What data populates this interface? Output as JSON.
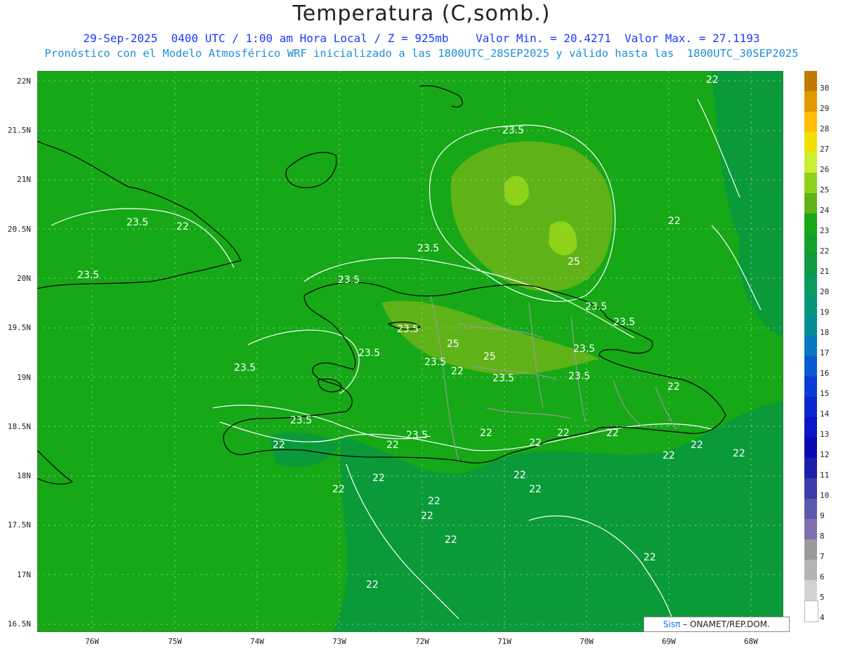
{
  "header": {
    "title": "Temperatura (C,somb.)",
    "subtitle_line1": "29-Sep-2025  0400 UTC / 1:00 am Hora Local / Z = 925mb    Valor Min. = 20.4271  Valor Max. = 27.1193",
    "subtitle_line2": "Pronóstico con el Modelo Atmosférico WRF inicializado a las 1800UTC_28SEP2025 y válido hasta las  1800UTC_30SEP2025"
  },
  "map": {
    "lat_labels": [
      "22N",
      "21.5N",
      "21N",
      "20.5N",
      "20N",
      "19.5N",
      "19N",
      "18.5N",
      "18N",
      "17.5N",
      "17N",
      "16.5N"
    ],
    "lon_labels": [
      "76W",
      "75W",
      "74W",
      "73W",
      "72W",
      "71W",
      "70W",
      "69W",
      "68W"
    ],
    "contour_labels": [
      "22",
      "23.5",
      "22",
      "23.5",
      "23.5",
      "23.5",
      "23.5",
      "25",
      "22",
      "25",
      "23.5",
      "23.5",
      "23.5",
      "23.5",
      "23.5",
      "23.5",
      "23.5",
      "25",
      "22",
      "23.5",
      "23.5",
      "22",
      "23.5",
      "22",
      "22",
      "23.5",
      "22",
      "22",
      "22",
      "22",
      "22",
      "22",
      "22",
      "22",
      "22",
      "22",
      "22",
      "22",
      "22",
      "22",
      "22",
      "22"
    ],
    "colors": {
      "background": "#16a816",
      "dark": "#0a9a3a",
      "light": "#5fb318",
      "lighter": "#8ed21a",
      "coast": "#000000",
      "borders": "#999999",
      "contour": "#ffffff"
    }
  },
  "colorbar": {
    "labels": [
      "30",
      "29",
      "28",
      "27",
      "26",
      "25",
      "24",
      "23",
      "22",
      "21",
      "20",
      "19",
      "18",
      "17",
      "16",
      "15",
      "14",
      "13",
      "12",
      "11",
      "10",
      "9",
      "8",
      "7",
      "6",
      "5",
      "4"
    ],
    "colors": [
      "#c07a00",
      "#e09a00",
      "#ffbe00",
      "#f0e000",
      "#c8f030",
      "#8ed21a",
      "#5fb318",
      "#16a816",
      "#12a12a",
      "#0d9a40",
      "#0a9a5a",
      "#07957a",
      "#058c96",
      "#0a78c0",
      "#0a5ad0",
      "#0a3cd8",
      "#0a28d0",
      "#0a14c8",
      "#0a0ab4",
      "#1e1ea8",
      "#3c3ca8",
      "#5a5ab0",
      "#8070b0",
      "#9a9a9a",
      "#b4b4b4",
      "#d2d2d2",
      "#ffffff"
    ]
  },
  "credit": {
    "sis": "Sisπ",
    "rest": "– ONAMET/REP.DOM."
  }
}
